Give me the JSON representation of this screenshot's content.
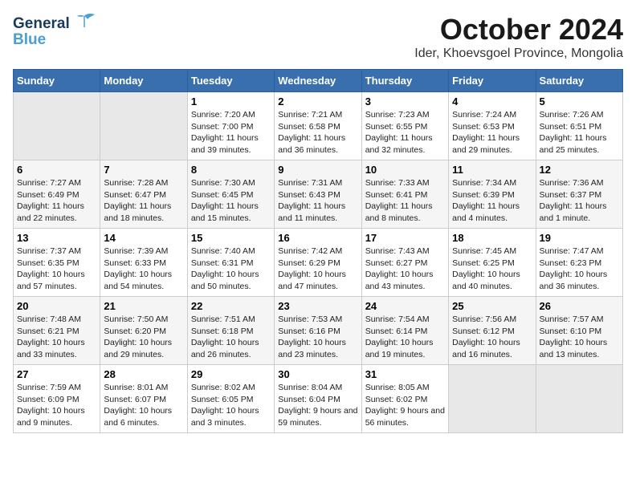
{
  "header": {
    "logo_general": "General",
    "logo_blue": "Blue",
    "month": "October 2024",
    "location": "Ider, Khoevsgoel Province, Mongolia"
  },
  "weekdays": [
    "Sunday",
    "Monday",
    "Tuesday",
    "Wednesday",
    "Thursday",
    "Friday",
    "Saturday"
  ],
  "weeks": [
    [
      {
        "day": "",
        "empty": true
      },
      {
        "day": "",
        "empty": true
      },
      {
        "day": "1",
        "sunrise": "7:20 AM",
        "sunset": "7:00 PM",
        "daylight": "11 hours and 39 minutes."
      },
      {
        "day": "2",
        "sunrise": "7:21 AM",
        "sunset": "6:58 PM",
        "daylight": "11 hours and 36 minutes."
      },
      {
        "day": "3",
        "sunrise": "7:23 AM",
        "sunset": "6:55 PM",
        "daylight": "11 hours and 32 minutes."
      },
      {
        "day": "4",
        "sunrise": "7:24 AM",
        "sunset": "6:53 PM",
        "daylight": "11 hours and 29 minutes."
      },
      {
        "day": "5",
        "sunrise": "7:26 AM",
        "sunset": "6:51 PM",
        "daylight": "11 hours and 25 minutes."
      }
    ],
    [
      {
        "day": "6",
        "sunrise": "7:27 AM",
        "sunset": "6:49 PM",
        "daylight": "11 hours and 22 minutes."
      },
      {
        "day": "7",
        "sunrise": "7:28 AM",
        "sunset": "6:47 PM",
        "daylight": "11 hours and 18 minutes."
      },
      {
        "day": "8",
        "sunrise": "7:30 AM",
        "sunset": "6:45 PM",
        "daylight": "11 hours and 15 minutes."
      },
      {
        "day": "9",
        "sunrise": "7:31 AM",
        "sunset": "6:43 PM",
        "daylight": "11 hours and 11 minutes."
      },
      {
        "day": "10",
        "sunrise": "7:33 AM",
        "sunset": "6:41 PM",
        "daylight": "11 hours and 8 minutes."
      },
      {
        "day": "11",
        "sunrise": "7:34 AM",
        "sunset": "6:39 PM",
        "daylight": "11 hours and 4 minutes."
      },
      {
        "day": "12",
        "sunrise": "7:36 AM",
        "sunset": "6:37 PM",
        "daylight": "11 hours and 1 minute."
      }
    ],
    [
      {
        "day": "13",
        "sunrise": "7:37 AM",
        "sunset": "6:35 PM",
        "daylight": "10 hours and 57 minutes."
      },
      {
        "day": "14",
        "sunrise": "7:39 AM",
        "sunset": "6:33 PM",
        "daylight": "10 hours and 54 minutes."
      },
      {
        "day": "15",
        "sunrise": "7:40 AM",
        "sunset": "6:31 PM",
        "daylight": "10 hours and 50 minutes."
      },
      {
        "day": "16",
        "sunrise": "7:42 AM",
        "sunset": "6:29 PM",
        "daylight": "10 hours and 47 minutes."
      },
      {
        "day": "17",
        "sunrise": "7:43 AM",
        "sunset": "6:27 PM",
        "daylight": "10 hours and 43 minutes."
      },
      {
        "day": "18",
        "sunrise": "7:45 AM",
        "sunset": "6:25 PM",
        "daylight": "10 hours and 40 minutes."
      },
      {
        "day": "19",
        "sunrise": "7:47 AM",
        "sunset": "6:23 PM",
        "daylight": "10 hours and 36 minutes."
      }
    ],
    [
      {
        "day": "20",
        "sunrise": "7:48 AM",
        "sunset": "6:21 PM",
        "daylight": "10 hours and 33 minutes."
      },
      {
        "day": "21",
        "sunrise": "7:50 AM",
        "sunset": "6:20 PM",
        "daylight": "10 hours and 29 minutes."
      },
      {
        "day": "22",
        "sunrise": "7:51 AM",
        "sunset": "6:18 PM",
        "daylight": "10 hours and 26 minutes."
      },
      {
        "day": "23",
        "sunrise": "7:53 AM",
        "sunset": "6:16 PM",
        "daylight": "10 hours and 23 minutes."
      },
      {
        "day": "24",
        "sunrise": "7:54 AM",
        "sunset": "6:14 PM",
        "daylight": "10 hours and 19 minutes."
      },
      {
        "day": "25",
        "sunrise": "7:56 AM",
        "sunset": "6:12 PM",
        "daylight": "10 hours and 16 minutes."
      },
      {
        "day": "26",
        "sunrise": "7:57 AM",
        "sunset": "6:10 PM",
        "daylight": "10 hours and 13 minutes."
      }
    ],
    [
      {
        "day": "27",
        "sunrise": "7:59 AM",
        "sunset": "6:09 PM",
        "daylight": "10 hours and 9 minutes."
      },
      {
        "day": "28",
        "sunrise": "8:01 AM",
        "sunset": "6:07 PM",
        "daylight": "10 hours and 6 minutes."
      },
      {
        "day": "29",
        "sunrise": "8:02 AM",
        "sunset": "6:05 PM",
        "daylight": "10 hours and 3 minutes."
      },
      {
        "day": "30",
        "sunrise": "8:04 AM",
        "sunset": "6:04 PM",
        "daylight": "9 hours and 59 minutes."
      },
      {
        "day": "31",
        "sunrise": "8:05 AM",
        "sunset": "6:02 PM",
        "daylight": "9 hours and 56 minutes."
      },
      {
        "day": "",
        "empty": true
      },
      {
        "day": "",
        "empty": true
      }
    ]
  ],
  "labels": {
    "sunrise": "Sunrise:",
    "sunset": "Sunset:",
    "daylight": "Daylight:"
  }
}
